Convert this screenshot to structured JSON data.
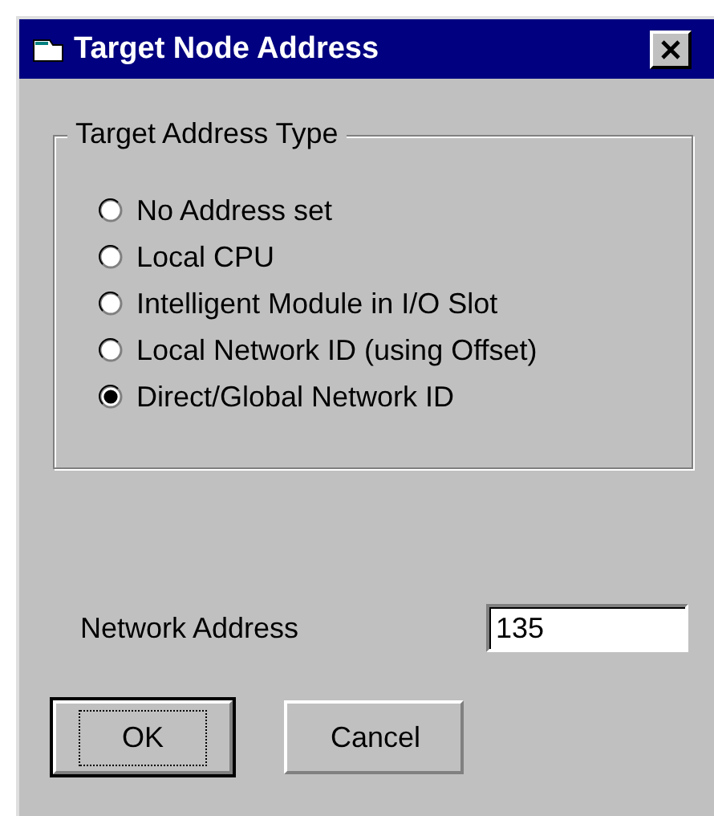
{
  "window": {
    "title": "Target Node Address"
  },
  "address_type": {
    "label": "Target Address Type",
    "options": [
      {
        "label": "No Address set",
        "selected": false
      },
      {
        "label": "Local CPU",
        "selected": false
      },
      {
        "label": "Intelligent Module in I/O Slot",
        "selected": false
      },
      {
        "label": "Local Network ID (using Offset)",
        "selected": false
      },
      {
        "label": "Direct/Global Network ID",
        "selected": true
      }
    ]
  },
  "network_address": {
    "label": "Network Address",
    "value": "135"
  },
  "buttons": [
    {
      "label": "OK",
      "default": true
    },
    {
      "label": "Cancel",
      "default": false
    }
  ]
}
